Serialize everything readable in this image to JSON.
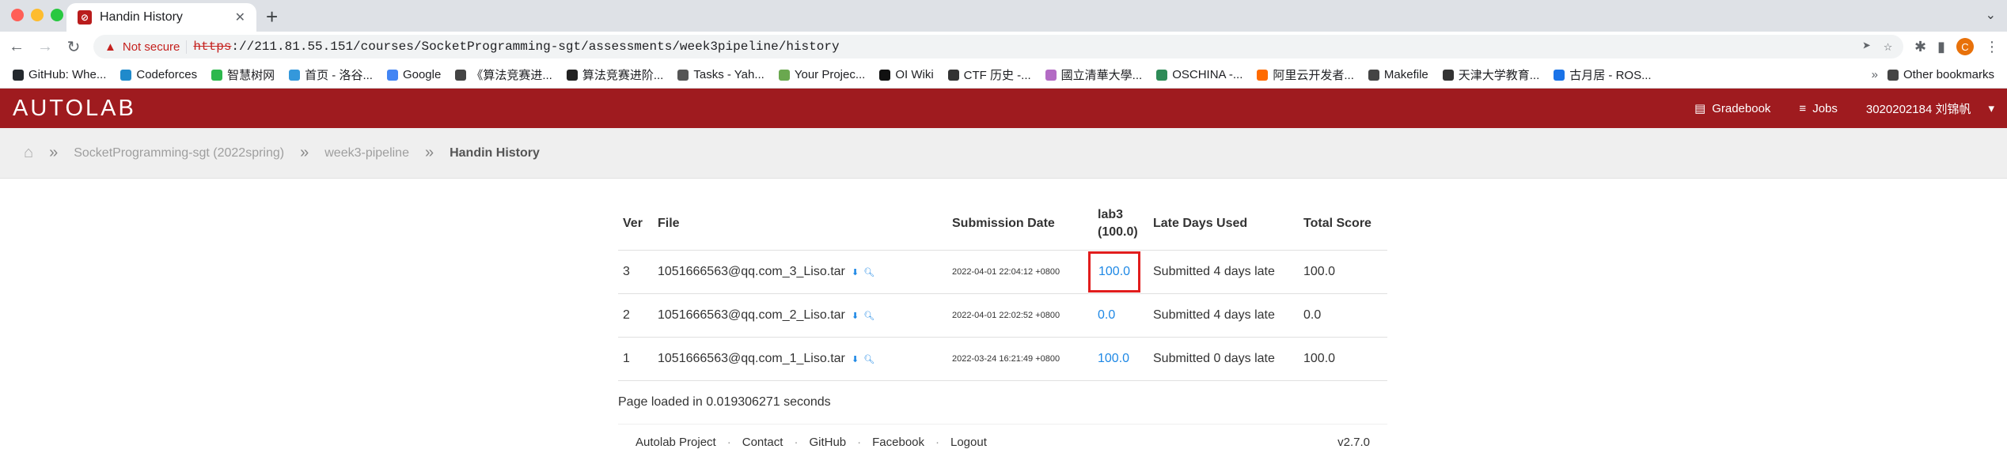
{
  "browser": {
    "tab_title": "Handin History",
    "url_warning": "Not secure",
    "url_scheme": "https",
    "url_rest": "://211.81.55.151/courses/SocketProgramming-sgt/assessments/week3pipeline/history",
    "profile_initial": "C",
    "bookmarks": [
      {
        "label": "GitHub: Whe...",
        "icon": "github-icon",
        "color": "#24292e"
      },
      {
        "label": "Codeforces",
        "icon": "codeforces-icon",
        "color": "#1f8acb"
      },
      {
        "label": "智慧树网",
        "icon": "zhihuishu-icon",
        "color": "#2db84d"
      },
      {
        "label": "首页 - 洛谷...",
        "icon": "luogu-icon",
        "color": "#3498db"
      },
      {
        "label": "Google",
        "icon": "google-icon",
        "color": "#4285f4"
      },
      {
        "label": "《算法竞赛进...",
        "icon": "book-icon",
        "color": "#444444"
      },
      {
        "label": "算法竞赛进阶...",
        "icon": "book-icon",
        "color": "#222222"
      },
      {
        "label": "Tasks - Yah...",
        "icon": "tasks-icon",
        "color": "#555555"
      },
      {
        "label": "Your Projec...",
        "icon": "project-icon",
        "color": "#6aa84f"
      },
      {
        "label": "OI Wiki",
        "icon": "oiwiki-icon",
        "color": "#111111"
      },
      {
        "label": "CTF 历史 -...",
        "icon": "ctf-icon",
        "color": "#333333"
      },
      {
        "label": "國立清華大學...",
        "icon": "nthu-icon",
        "color": "#b36bc4"
      },
      {
        "label": "OSCHINA -...",
        "icon": "oschina-icon",
        "color": "#2e8b57"
      },
      {
        "label": "阿里云开发者...",
        "icon": "aliyun-icon",
        "color": "#ff6a00"
      },
      {
        "label": "Makefile",
        "icon": "folder-icon",
        "color": "#444444"
      },
      {
        "label": "天津大学教育...",
        "icon": "globe-icon",
        "color": "#333333"
      },
      {
        "label": "古月居 - ROS...",
        "icon": "grid-icon",
        "color": "#1a73e8"
      }
    ],
    "other_bookmarks": "Other bookmarks"
  },
  "nav": {
    "logo": "AUTOLAB",
    "gradebook": "Gradebook",
    "jobs": "Jobs",
    "user": "3020202184 刘锦帆"
  },
  "breadcrumb": {
    "course": "SocketProgramming-sgt (2022spring)",
    "assessment": "week3-pipeline",
    "current": "Handin History"
  },
  "table": {
    "headers": {
      "ver": "Ver",
      "file": "File",
      "date": "Submission Date",
      "problem_line1": "lab3",
      "problem_line2": "(100.0)",
      "late": "Late Days Used",
      "total": "Total Score"
    },
    "rows": [
      {
        "ver": "3",
        "file": "1051666563@qq.com_3_Liso.tar",
        "date": "2022-04-01 22:04:12 +0800",
        "score": "100.0",
        "late": "Submitted 4 days late",
        "total": "100.0"
      },
      {
        "ver": "2",
        "file": "1051666563@qq.com_2_Liso.tar",
        "date": "2022-04-01 22:02:52 +0800",
        "score": "0.0",
        "late": "Submitted 4 days late",
        "total": "0.0"
      },
      {
        "ver": "1",
        "file": "1051666563@qq.com_1_Liso.tar",
        "date": "2022-03-24 16:21:49 +0800",
        "score": "100.0",
        "late": "Submitted 0 days late",
        "total": "100.0"
      }
    ]
  },
  "load_time": "Page loaded in 0.019306271 seconds",
  "footer": {
    "links": [
      "Autolab Project",
      "Contact",
      "GitHub",
      "Facebook",
      "Logout"
    ],
    "version": "v2.7.0"
  }
}
